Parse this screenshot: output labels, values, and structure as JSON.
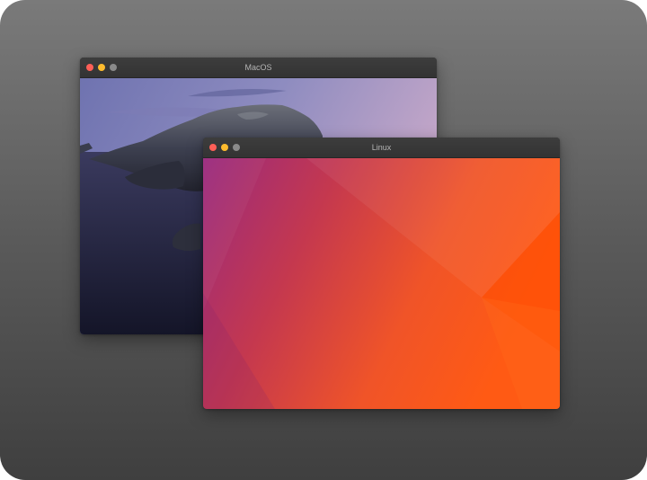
{
  "windows": [
    {
      "title": "MacOS",
      "controls": [
        "close-button",
        "minimize-button",
        "maximize-button"
      ],
      "wallpaper": "macos-catalina-island"
    },
    {
      "title": "Linux",
      "controls": [
        "close-button",
        "minimize-button",
        "maximize-button"
      ],
      "wallpaper": "ubuntu-gradient"
    }
  ],
  "colors": {
    "close": "#fe5f57",
    "minimize": "#febc2e",
    "maximize": "#8a8a8a",
    "titlebar": "#383838",
    "desktop_top": "#7a7a7a",
    "desktop_bottom": "#3f3f3f",
    "ubuntu_purple": "#9c2a7f",
    "ubuntu_orange": "#ff5400"
  }
}
